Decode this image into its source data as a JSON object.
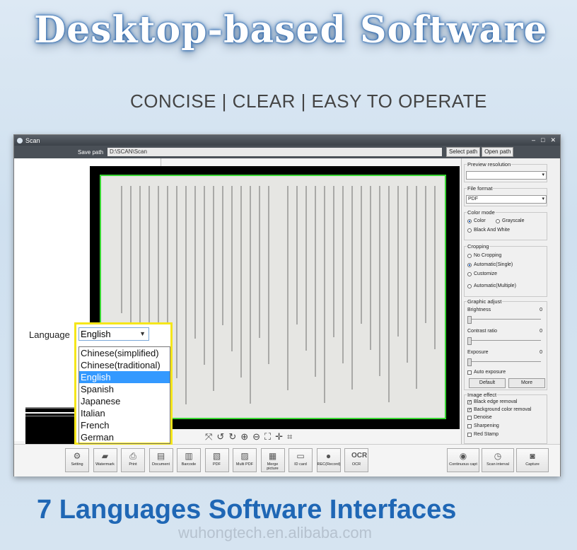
{
  "headline": "Desktop-based Software",
  "tagline": "CONCISE | CLEAR | EASY TO OPERATE",
  "window": {
    "title": "Scan",
    "save_path_label": "Save path",
    "save_path_value": "D:\\SCAN\\Scan",
    "select_path": "Select path",
    "open_path": "Open path"
  },
  "language": {
    "label": "Language",
    "selected": "English",
    "options": [
      "Chinese(simplified)",
      "Chinese(traditional)",
      "English",
      "Spanish",
      "Japanese",
      "Italian",
      "French",
      "German"
    ]
  },
  "settings": {
    "preview_resolution": "Preview resolution",
    "file_format": "File format",
    "file_format_value": "PDF",
    "color_mode": "Color mode",
    "color": "Color",
    "grayscale": "Grayscale",
    "black_white": "Black And White",
    "cropping": "Cropping",
    "no_cropping": "No Cropping",
    "auto_single": "Automatic(Single)",
    "customize": "Customize",
    "auto_multiple": "Automatic(Multiple)",
    "graphic_adjust": "Graphic adjust",
    "brightness": "Brightness",
    "brightness_val": "0",
    "contrast": "Contrast ratio",
    "contrast_val": "0",
    "exposure": "Exposure",
    "exposure_val": "0",
    "auto_exposure": "Auto exposure",
    "default_btn": "Default",
    "more_btn": "More",
    "image_effect": "Image effect",
    "black_edge": "Black edge removal",
    "bg_color": "Background color removal",
    "denoise": "Denoise",
    "sharpening": "Sharpening",
    "red_stamp": "Red Stamp"
  },
  "toolbar": [
    {
      "label": "Setting",
      "icon": "gear-icon",
      "glyph": "⚙"
    },
    {
      "label": "Watermark",
      "icon": "watermark-icon",
      "glyph": "▰"
    },
    {
      "label": "Print",
      "icon": "printer-icon",
      "glyph": "⎙"
    },
    {
      "label": "Document",
      "icon": "document-icon",
      "glyph": "▤"
    },
    {
      "label": "Barcode",
      "icon": "barcode-icon",
      "glyph": "▥"
    },
    {
      "label": "PDF",
      "icon": "pdf-icon",
      "glyph": "▧"
    },
    {
      "label": "Multi PDF",
      "icon": "multi-pdf-icon",
      "glyph": "▨"
    },
    {
      "label": "Merge picture",
      "icon": "merge-picture-icon",
      "glyph": "▦"
    },
    {
      "label": "ID card",
      "icon": "id-card-icon",
      "glyph": "▭"
    },
    {
      "label": "REC(Record)",
      "icon": "record-icon",
      "glyph": "●"
    },
    {
      "label": "OCR",
      "icon": "ocr-icon",
      "glyph": "OCR"
    }
  ],
  "right_toolbar": [
    {
      "label": "Continuous capt",
      "icon": "continuous-capture-icon",
      "glyph": "◉"
    },
    {
      "label": "Scan interval",
      "icon": "scan-interval-icon",
      "glyph": "◷"
    },
    {
      "label": "Capture",
      "icon": "camera-icon",
      "glyph": "◙"
    }
  ],
  "footer": "7 Languages Software Interfaces",
  "watermark": "wuhongtech.en.alibaba.com"
}
